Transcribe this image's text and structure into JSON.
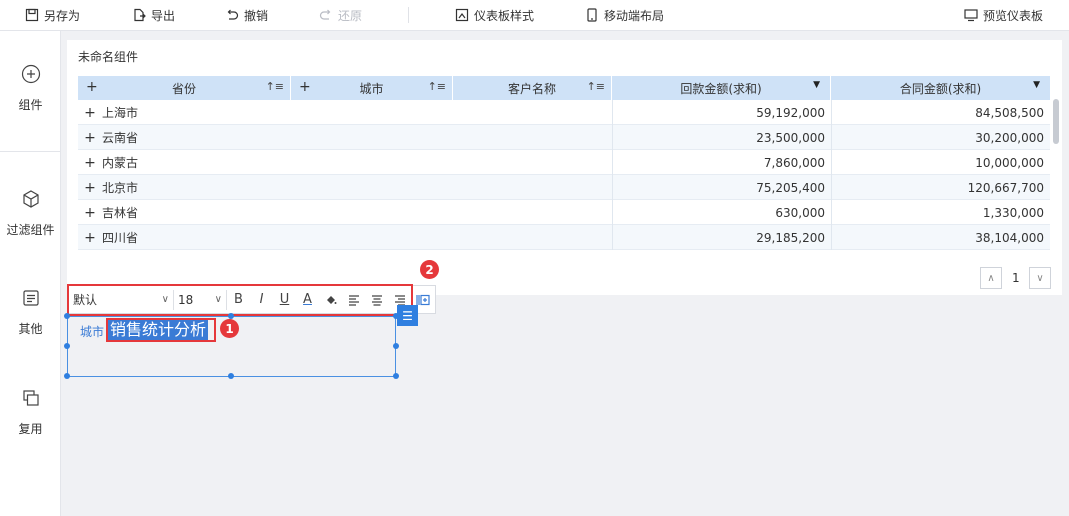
{
  "toolbar": {
    "save_as": "另存为",
    "export": "导出",
    "undo": "撤销",
    "redo": "还原",
    "dashboard_style": "仪表板样式",
    "mobile_layout": "移动端布局",
    "preview": "预览仪表板"
  },
  "sidebar": {
    "items": [
      {
        "label": "组件",
        "icon": "plus-circle-icon"
      },
      {
        "label": "过滤组件",
        "icon": "cube-icon"
      },
      {
        "label": "其他",
        "icon": "document-icon"
      },
      {
        "label": "复用",
        "icon": "layers-icon"
      }
    ]
  },
  "widget": {
    "title": "未命名组件",
    "columns": {
      "province": "省份",
      "city": "城市",
      "customer": "客户名称",
      "payment": "回款金额(求和)",
      "contract": "合同金额(求和)"
    },
    "rows": [
      {
        "province": "上海市",
        "payment": "59,192,000",
        "contract": "84,508,500"
      },
      {
        "province": "云南省",
        "payment": "23,500,000",
        "contract": "30,200,000"
      },
      {
        "province": "内蒙古",
        "payment": "7,860,000",
        "contract": "10,000,000"
      },
      {
        "province": "北京市",
        "payment": "75,205,400",
        "contract": "120,667,700"
      },
      {
        "province": "吉林省",
        "payment": "630,000",
        "contract": "1,330,000"
      },
      {
        "province": "四川省",
        "payment": "29,185,200",
        "contract": "38,104,000"
      }
    ],
    "pager": {
      "page": "1"
    }
  },
  "format_bar": {
    "font": "默认",
    "size": "18",
    "bold": "B",
    "italic": "I",
    "underline": "U",
    "font_color": "A"
  },
  "textbox": {
    "field": "城市",
    "selected_text": "销售统计分析"
  },
  "badges": {
    "one": "1",
    "two": "2"
  },
  "colors": {
    "accent": "#3a7bd5",
    "header_bg": "#cfe2f7",
    "annotation": "#e5383b"
  }
}
